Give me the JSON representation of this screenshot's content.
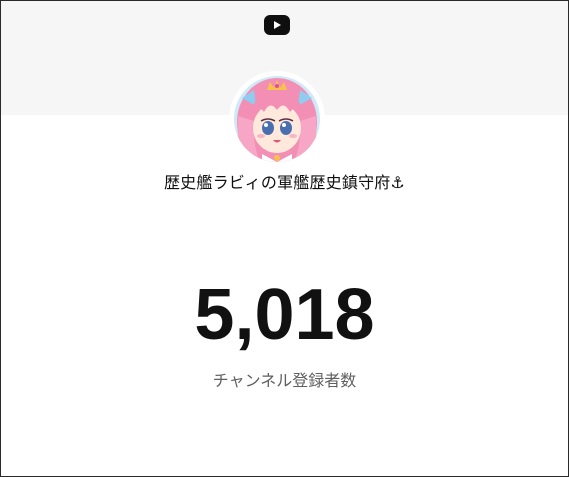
{
  "header": {
    "logo_icon": "youtube-play-icon",
    "banner_color": "#f6f6f6"
  },
  "channel": {
    "name": "歴史艦ラビィの軍艦歴史鎮守府⚓",
    "avatar_icon": "anime-girl-avatar"
  },
  "stats": {
    "subscriber_count": "5,018",
    "subscriber_label": "チャンネル登録者数"
  },
  "colors": {
    "count_text": "#111111",
    "label_text": "#606060",
    "logo_bg": "#0f0f0f"
  }
}
